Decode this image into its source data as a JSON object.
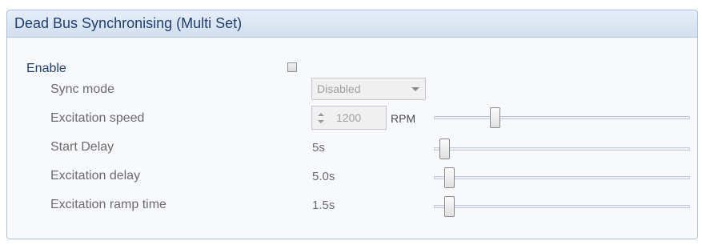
{
  "panel": {
    "title": "Dead Bus Synchronising (Multi Set)"
  },
  "enable": {
    "label": "Enable",
    "checked": false
  },
  "sync_mode": {
    "label": "Sync mode",
    "value": "Disabled"
  },
  "excitation_speed": {
    "label": "Excitation speed",
    "value": "1200",
    "unit": "RPM",
    "slider_fraction": 0.21
  },
  "start_delay": {
    "label": "Start Delay",
    "value": "5s",
    "slider_fraction": 0.0
  },
  "excitation_delay": {
    "label": "Excitation delay",
    "value": "5.0s",
    "slider_fraction": 0.02
  },
  "excitation_ramp_time": {
    "label": "Excitation ramp time",
    "value": "1.5s",
    "slider_fraction": 0.02
  }
}
